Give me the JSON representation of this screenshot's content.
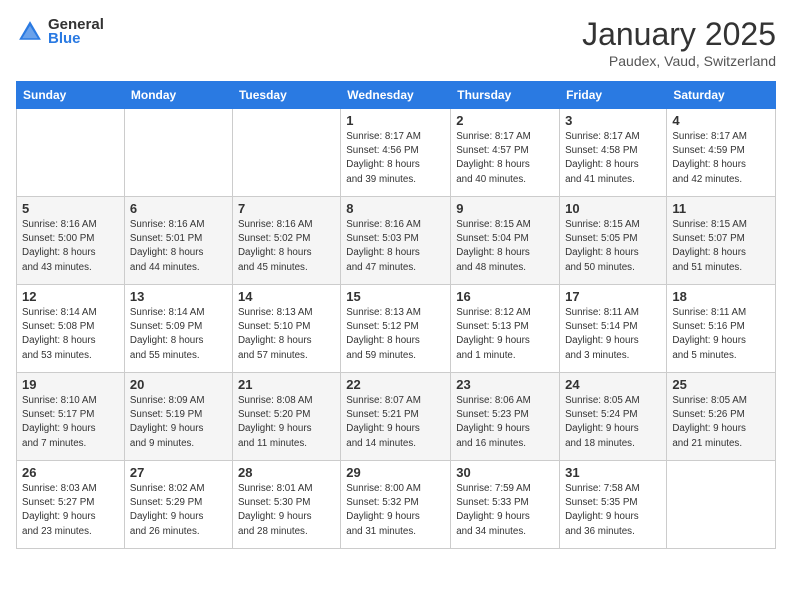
{
  "header": {
    "logo_general": "General",
    "logo_blue": "Blue",
    "title": "January 2025",
    "subtitle": "Paudex, Vaud, Switzerland"
  },
  "weekdays": [
    "Sunday",
    "Monday",
    "Tuesday",
    "Wednesday",
    "Thursday",
    "Friday",
    "Saturday"
  ],
  "weeks": [
    [
      {
        "day": "",
        "info": ""
      },
      {
        "day": "",
        "info": ""
      },
      {
        "day": "",
        "info": ""
      },
      {
        "day": "1",
        "info": "Sunrise: 8:17 AM\nSunset: 4:56 PM\nDaylight: 8 hours\nand 39 minutes."
      },
      {
        "day": "2",
        "info": "Sunrise: 8:17 AM\nSunset: 4:57 PM\nDaylight: 8 hours\nand 40 minutes."
      },
      {
        "day": "3",
        "info": "Sunrise: 8:17 AM\nSunset: 4:58 PM\nDaylight: 8 hours\nand 41 minutes."
      },
      {
        "day": "4",
        "info": "Sunrise: 8:17 AM\nSunset: 4:59 PM\nDaylight: 8 hours\nand 42 minutes."
      }
    ],
    [
      {
        "day": "5",
        "info": "Sunrise: 8:16 AM\nSunset: 5:00 PM\nDaylight: 8 hours\nand 43 minutes."
      },
      {
        "day": "6",
        "info": "Sunrise: 8:16 AM\nSunset: 5:01 PM\nDaylight: 8 hours\nand 44 minutes."
      },
      {
        "day": "7",
        "info": "Sunrise: 8:16 AM\nSunset: 5:02 PM\nDaylight: 8 hours\nand 45 minutes."
      },
      {
        "day": "8",
        "info": "Sunrise: 8:16 AM\nSunset: 5:03 PM\nDaylight: 8 hours\nand 47 minutes."
      },
      {
        "day": "9",
        "info": "Sunrise: 8:15 AM\nSunset: 5:04 PM\nDaylight: 8 hours\nand 48 minutes."
      },
      {
        "day": "10",
        "info": "Sunrise: 8:15 AM\nSunset: 5:05 PM\nDaylight: 8 hours\nand 50 minutes."
      },
      {
        "day": "11",
        "info": "Sunrise: 8:15 AM\nSunset: 5:07 PM\nDaylight: 8 hours\nand 51 minutes."
      }
    ],
    [
      {
        "day": "12",
        "info": "Sunrise: 8:14 AM\nSunset: 5:08 PM\nDaylight: 8 hours\nand 53 minutes."
      },
      {
        "day": "13",
        "info": "Sunrise: 8:14 AM\nSunset: 5:09 PM\nDaylight: 8 hours\nand 55 minutes."
      },
      {
        "day": "14",
        "info": "Sunrise: 8:13 AM\nSunset: 5:10 PM\nDaylight: 8 hours\nand 57 minutes."
      },
      {
        "day": "15",
        "info": "Sunrise: 8:13 AM\nSunset: 5:12 PM\nDaylight: 8 hours\nand 59 minutes."
      },
      {
        "day": "16",
        "info": "Sunrise: 8:12 AM\nSunset: 5:13 PM\nDaylight: 9 hours\nand 1 minute."
      },
      {
        "day": "17",
        "info": "Sunrise: 8:11 AM\nSunset: 5:14 PM\nDaylight: 9 hours\nand 3 minutes."
      },
      {
        "day": "18",
        "info": "Sunrise: 8:11 AM\nSunset: 5:16 PM\nDaylight: 9 hours\nand 5 minutes."
      }
    ],
    [
      {
        "day": "19",
        "info": "Sunrise: 8:10 AM\nSunset: 5:17 PM\nDaylight: 9 hours\nand 7 minutes."
      },
      {
        "day": "20",
        "info": "Sunrise: 8:09 AM\nSunset: 5:19 PM\nDaylight: 9 hours\nand 9 minutes."
      },
      {
        "day": "21",
        "info": "Sunrise: 8:08 AM\nSunset: 5:20 PM\nDaylight: 9 hours\nand 11 minutes."
      },
      {
        "day": "22",
        "info": "Sunrise: 8:07 AM\nSunset: 5:21 PM\nDaylight: 9 hours\nand 14 minutes."
      },
      {
        "day": "23",
        "info": "Sunrise: 8:06 AM\nSunset: 5:23 PM\nDaylight: 9 hours\nand 16 minutes."
      },
      {
        "day": "24",
        "info": "Sunrise: 8:05 AM\nSunset: 5:24 PM\nDaylight: 9 hours\nand 18 minutes."
      },
      {
        "day": "25",
        "info": "Sunrise: 8:05 AM\nSunset: 5:26 PM\nDaylight: 9 hours\nand 21 minutes."
      }
    ],
    [
      {
        "day": "26",
        "info": "Sunrise: 8:03 AM\nSunset: 5:27 PM\nDaylight: 9 hours\nand 23 minutes."
      },
      {
        "day": "27",
        "info": "Sunrise: 8:02 AM\nSunset: 5:29 PM\nDaylight: 9 hours\nand 26 minutes."
      },
      {
        "day": "28",
        "info": "Sunrise: 8:01 AM\nSunset: 5:30 PM\nDaylight: 9 hours\nand 28 minutes."
      },
      {
        "day": "29",
        "info": "Sunrise: 8:00 AM\nSunset: 5:32 PM\nDaylight: 9 hours\nand 31 minutes."
      },
      {
        "day": "30",
        "info": "Sunrise: 7:59 AM\nSunset: 5:33 PM\nDaylight: 9 hours\nand 34 minutes."
      },
      {
        "day": "31",
        "info": "Sunrise: 7:58 AM\nSunset: 5:35 PM\nDaylight: 9 hours\nand 36 minutes."
      },
      {
        "day": "",
        "info": ""
      }
    ]
  ]
}
